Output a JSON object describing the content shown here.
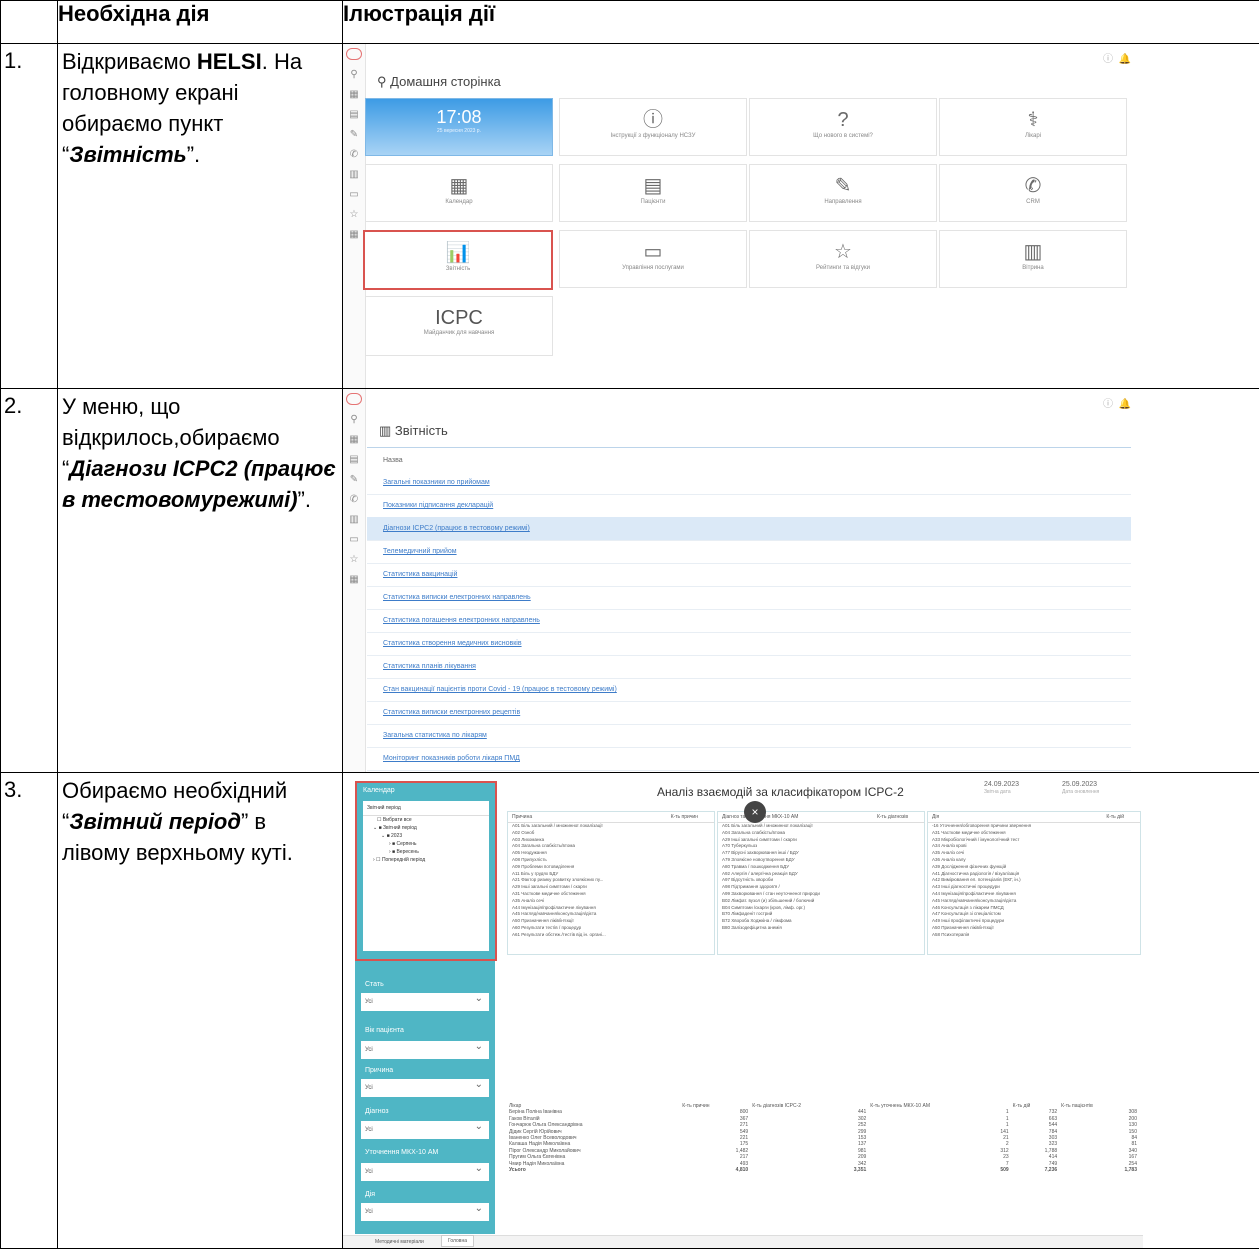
{
  "headers": {
    "col1": "",
    "col2": "Необхідна дія",
    "col3": "Ілюстрація дії"
  },
  "rows": [
    {
      "num": "1.",
      "text_parts": [
        "Відкриваємо ",
        "HELSI",
        ". На головному екрані обираємо пункт “",
        "Звітність",
        "”."
      ]
    },
    {
      "num": "2.",
      "text_parts": [
        "У меню, що відкрилось,обираємо “",
        "Діагнози ICPC2 (працює в тестовомурежимі)",
        "”."
      ]
    },
    {
      "num": "3.",
      "text_parts": [
        "Обираємо необхідний “",
        "Звітний період",
        "” в лівому верхньому куті."
      ]
    }
  ],
  "shot1": {
    "title": "Домашня сторінка",
    "clock": {
      "time": "17:08",
      "date": "25 вересня 2023 р."
    },
    "tiles": [
      {
        "icon": "ⓘ",
        "label": "Інструкції з функціоналу НСЗУ"
      },
      {
        "icon": "?",
        "label": "Що нового в системі?"
      },
      {
        "icon": "⚕",
        "label": "Лікарі"
      },
      {
        "icon": "▦",
        "label": "Календар"
      },
      {
        "icon": "▤",
        "label": "Пацієнти"
      },
      {
        "icon": "✎",
        "label": "Направлення"
      },
      {
        "icon": "✆",
        "label": "CRM"
      },
      {
        "icon": "📊",
        "label": "Звітність"
      },
      {
        "icon": "▭",
        "label": "Управління послугами"
      },
      {
        "icon": "☆",
        "label": "Рейтинги та відгуки"
      },
      {
        "icon": "▥",
        "label": "Вітрина"
      }
    ],
    "icpc": {
      "title": "ICPC",
      "label": "Майданчик для навчання"
    }
  },
  "shot2": {
    "title": "Звітність",
    "col": "Назва",
    "items": [
      "Загальні показники по прийомам",
      "Показники підписання декларацій",
      "Діагнози ICPC2 (працює в тестовому режимі)",
      "Телемедичний прийом",
      "Статистика вакцинацій",
      "Статистика виписки електронних направлень",
      "Статистика погашення електронних направлень",
      "Статистика створення медичних висновків",
      "Статистика планів лікування",
      "Стан вакцинації пацієнтів проти Covid - 19 (працює в тестовому режимі)",
      "Статистика виписки електронних рецептів",
      "Загальна статистика по лікарям",
      "Моніторинг показників роботи лікаря ПМД"
    ]
  },
  "shot3": {
    "title": "Аналіз взаємодій за класифікатором ICPC-2",
    "date1": "24.09.2023",
    "date1_lbl": "Звітна дата",
    "date2": "25.09.2023",
    "date2_lbl": "Дата оновлення",
    "calendar": "Календар",
    "period_lbl": "Звітний період",
    "tree": [
      "Вибрати все",
      "Звітний період",
      "2023",
      "Серпень",
      "Вересень",
      "Попередній період"
    ],
    "filters": [
      {
        "label": "Стать",
        "value": "Усі"
      },
      {
        "label": "Вік пацієнта",
        "value": "Усі"
      },
      {
        "label": "Причина",
        "value": "Усі"
      },
      {
        "label": "Діагноз",
        "value": "Усі"
      },
      {
        "label": "Уточнення МКХ-10 АМ",
        "value": "Усі"
      },
      {
        "label": "Дія",
        "value": "Усі"
      }
    ],
    "p1_head": "Причина",
    "p1_head2": "К-ть причин",
    "p1": [
      "A01 Біль загальний / множинної локалізації",
      "A02 Озноб",
      "A03 Лихоманка",
      "A04 Загальна слабкість/втома",
      "A05 Нездужання",
      "A08 Припухлість",
      "A09 Проблеми потовиділення",
      "A11 Біль у грудях БДУ",
      "A21 Фактор ризику розвитку злоякісних пу...",
      "A29 Інші загальні симптоми / скарги",
      "A31 Часткове медичне обстеження",
      "A35 Аналіз сечі",
      "A44 Імунізація/профілактичне лікування",
      "A45 Нагляд/навчання/консультація/дієта",
      "A50 Призначення ліків/ін'єкції",
      "A60 Результати тестів / процедур",
      "A61 Результати обстеж./тестів від ін. органі..."
    ],
    "p2_head": "Діагноз та уточнення МКХ-10 АМ",
    "p2_head2": "К-ть діагнозів",
    "p2": [
      "A01 Біль загальний / множинної локалізації",
      "A04 Загальна слабкість/втома",
      "A29 Інші загальні симптоми / скарги",
      "A70 Туберкульоз",
      "A77 Вірусні захворювання інші / БДУ",
      "A79 Злоякісне новоутворення БДУ",
      "A80 Травма / пошкодження БДУ",
      "A92 Алергія / алергічна реакція БДУ",
      "A97 Відсутність хвороби",
      "A98 Підтримання здоров'я /",
      "A99 Захворювання / стан неуточненої природи",
      "B02 Лімфат. вузол (и) збільшений / болючий",
      "B04 Симптоми /скарги (кров, лімф. орг.)",
      "B70 Лімфаденіт гострий",
      "B72 Хвороба Ходжкіна / лімфома",
      "B80 Залізодефіцитна анемія"
    ],
    "p3_head": "Дія",
    "p3_head2": "К-ть дій",
    "p3": [
      "-16 Уточнення/обговорення причини звернення",
      "A31 Часткове медичне обстеження",
      "A33 Мікробіологічний / імунологічний тест",
      "A34 Аналіз крові",
      "A35 Аналіз сечі",
      "A36 Аналіз калу",
      "A39 Дослідження фізичних функцій",
      "A41 Діагностична радіологія / візуалізація",
      "A42 Вимірювання ел. потенціалів (ЕКГ, ін.)",
      "A43 Інші діагностичні процедури",
      "A44 Імунізація/профілактичне лікування",
      "A45 Нагляд/навчання/консультація/дієта",
      "A46 Консультація з лікарем ПМСД",
      "A47 Консультація зі спеціалістом",
      "A49 Інші профілактичні процедури",
      "A50 Призначення ліків/ін'єкції",
      "A58 Психотерапія"
    ],
    "bottom_head": [
      "Лікар",
      "К-ть причин",
      "К-ть діагнозів ICPC-2",
      "К-ть уточнень МКХ-10 АМ",
      "К-ть дій",
      "К-ть пацієнтів"
    ],
    "bottom": [
      [
        "Беріна Поліна Іванівна",
        "800",
        "441",
        "1",
        "732",
        "308"
      ],
      [
        "Гаков Віталій",
        "367",
        "302",
        "1",
        "663",
        "200"
      ],
      [
        "Гончарюк Ольга Олександрівна",
        "271",
        "252",
        "1",
        "544",
        "130"
      ],
      [
        "Дідик Сергій Юрійович",
        "549",
        "299",
        "141",
        "784",
        "150"
      ],
      [
        "Іваненко Олег Всеволодович",
        "221",
        "153",
        "21",
        "303",
        "84"
      ],
      [
        "Калаша Надія Миколаївна",
        "175",
        "137",
        "2",
        "323",
        "81"
      ],
      [
        "Пірог Олександр Миколайович",
        "1,482",
        "981",
        "312",
        "1,788",
        "340"
      ],
      [
        "Пругим Ольга Євгенівна",
        "217",
        "209",
        "23",
        "414",
        "167"
      ],
      [
        "Чмир Надія Миколаївна",
        "493",
        "342",
        "7",
        "749",
        "254"
      ],
      [
        "Усього",
        "4,810",
        "3,351",
        "509",
        "7,236",
        "1,783"
      ]
    ],
    "tab1": "Методичні матеріали",
    "tab2": "Головна"
  }
}
